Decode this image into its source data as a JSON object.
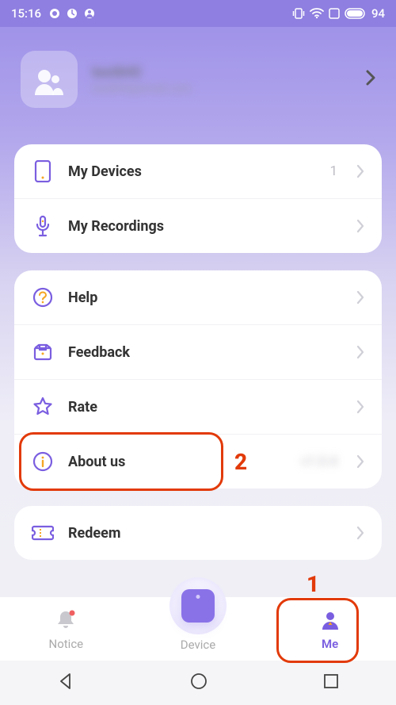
{
  "status": {
    "time": "15:16",
    "battery": "94"
  },
  "profile": {
    "name": "test845",
    "email": "test845@email.com"
  },
  "groups": [
    {
      "rows": [
        {
          "icon": "device-icon",
          "label": "My Devices",
          "meta": "1"
        },
        {
          "icon": "mic-icon",
          "label": "My Recordings",
          "meta": ""
        }
      ]
    },
    {
      "rows": [
        {
          "icon": "help-icon",
          "label": "Help",
          "meta": ""
        },
        {
          "icon": "feedback-icon",
          "label": "Feedback",
          "meta": ""
        },
        {
          "icon": "star-icon",
          "label": "Rate",
          "meta": ""
        },
        {
          "icon": "info-icon",
          "label": "About us",
          "meta": "v1.0.4"
        }
      ]
    },
    {
      "rows": [
        {
          "icon": "ticket-icon",
          "label": "Redeem",
          "meta": ""
        }
      ]
    }
  ],
  "tabs": {
    "notice": "Notice",
    "device": "Device",
    "me": "Me"
  },
  "annotations": {
    "a1": "1",
    "a2": "2"
  }
}
